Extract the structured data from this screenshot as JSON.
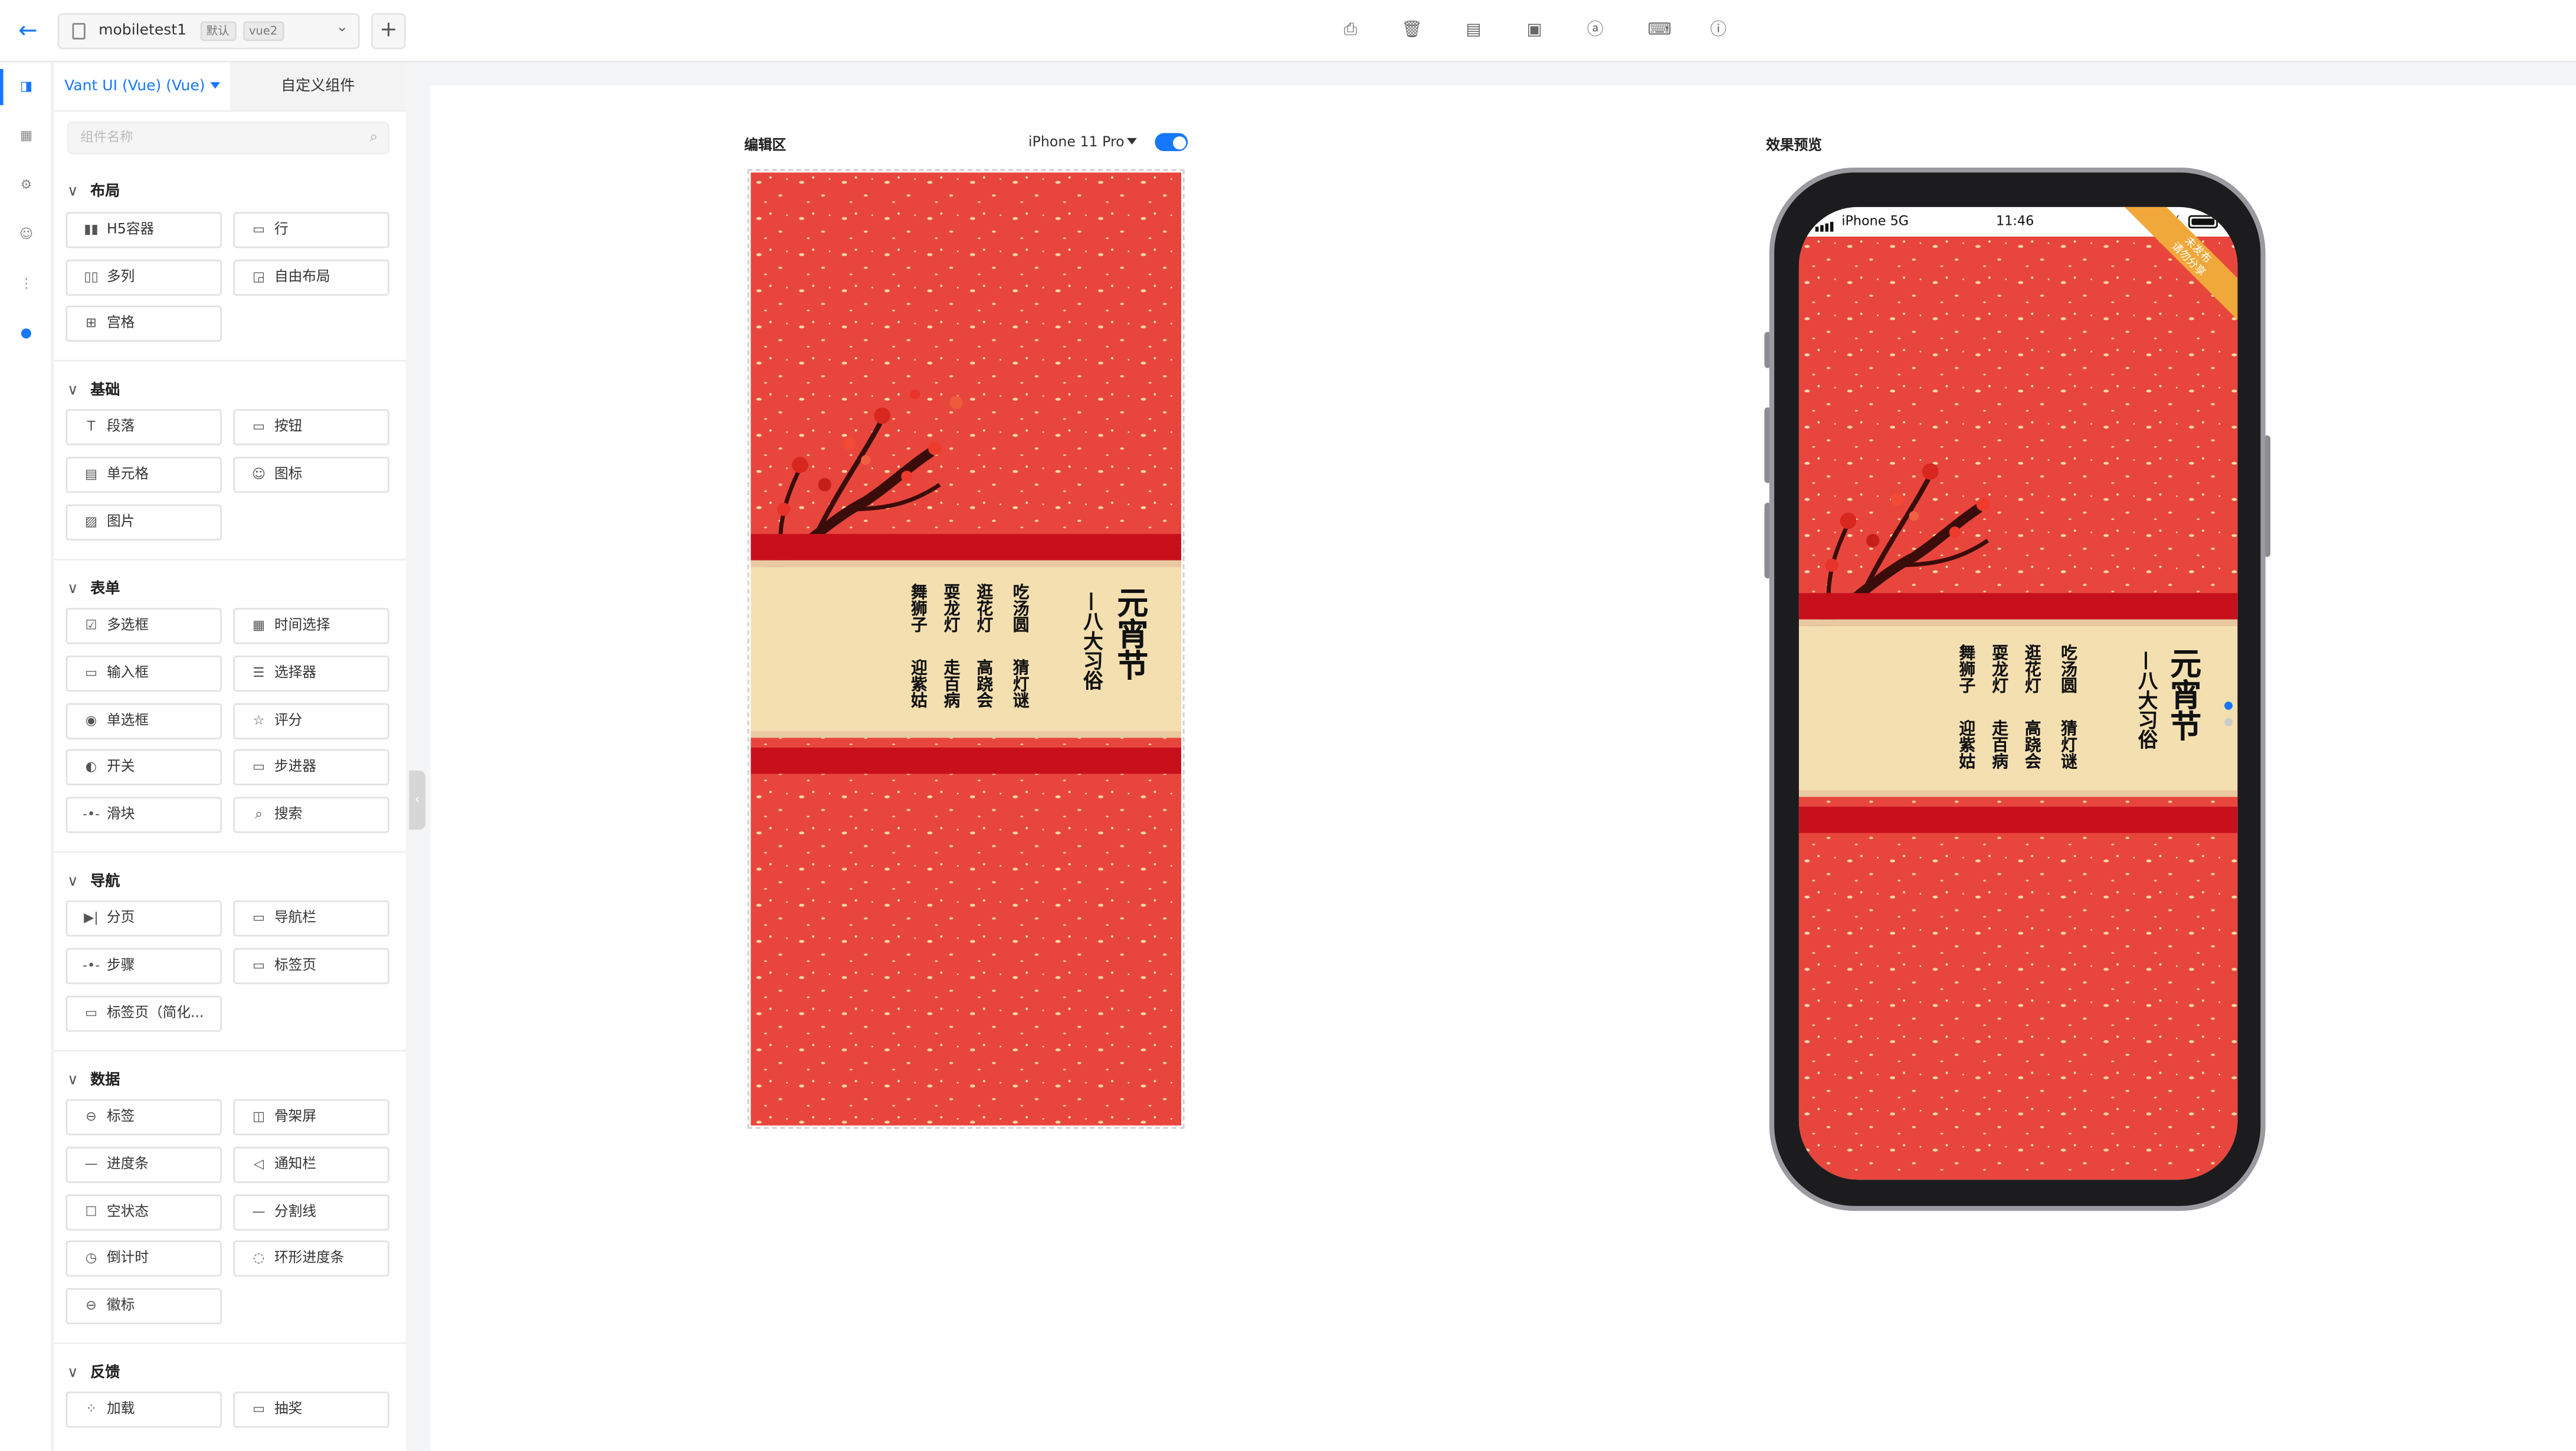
{
  "topbar": {
    "project_name": "mobiletest1",
    "tag_default": "默认",
    "tag_framework": "vue2",
    "add_label": "+",
    "toolbar_icons": [
      "stamp-icon",
      "trash-icon",
      "calendar-icon",
      "js-icon",
      "at-sign-icon",
      "keyboard-icon",
      "help-icon"
    ]
  },
  "rail": {
    "icons": [
      "components-icon",
      "pages-icon",
      "settings-icon",
      "smiley-icon",
      "tree-icon",
      "ai-icon"
    ]
  },
  "panel": {
    "tabs": [
      {
        "label": "Vant UI (Vue) (Vue)"
      },
      {
        "label": "自定义组件"
      }
    ],
    "search_placeholder": "组件名称",
    "sections": [
      {
        "title": "布局",
        "items": [
          "H5容器",
          "行",
          "多列",
          "自由布局",
          "宫格"
        ]
      },
      {
        "title": "基础",
        "items": [
          "段落",
          "按钮",
          "单元格",
          "图标",
          "图片"
        ]
      },
      {
        "title": "表单",
        "items": [
          "多选框",
          "时间选择",
          "输入框",
          "选择器",
          "单选框",
          "评分",
          "开关",
          "步进器",
          "滑块",
          "搜索"
        ]
      },
      {
        "title": "导航",
        "items": [
          "分页",
          "导航栏",
          "步骤",
          "标签页",
          "标签页（简化..."
        ]
      },
      {
        "title": "数据",
        "items": [
          "标签",
          "骨架屏",
          "进度条",
          "通知栏",
          "空状态",
          "分割线",
          "倒计时",
          "环形进度条",
          "徽标"
        ]
      },
      {
        "title": "反馈",
        "items": [
          "加载",
          "抽奖"
        ]
      }
    ]
  },
  "editor": {
    "label": "编辑区",
    "device": "iPhone 11 Pro",
    "toggle_on": true
  },
  "preview": {
    "label": "效果预览",
    "carrier": "iPhone 5G",
    "time": "11:46",
    "battery": "100%",
    "ribbon_line1": "未发布",
    "ribbon_line2": "请勿分享"
  },
  "poster": {
    "title": "元宵节",
    "subtitle": "—八大习俗",
    "customs_col1": "吃汤圆",
    "customs_col2": "猜灯谜",
    "customs_col3": "逛花灯",
    "customs_col4": "高跷会",
    "customs_col5": "耍龙灯",
    "customs_col6": "走百病",
    "customs_col7": "舞狮子",
    "customs_col8": "迎紫姑"
  },
  "colors": {
    "accent": "#1677ff",
    "poster_red": "#e8463d",
    "banner_red": "#c8101c",
    "scroll_cream": "#f3dfb0"
  }
}
